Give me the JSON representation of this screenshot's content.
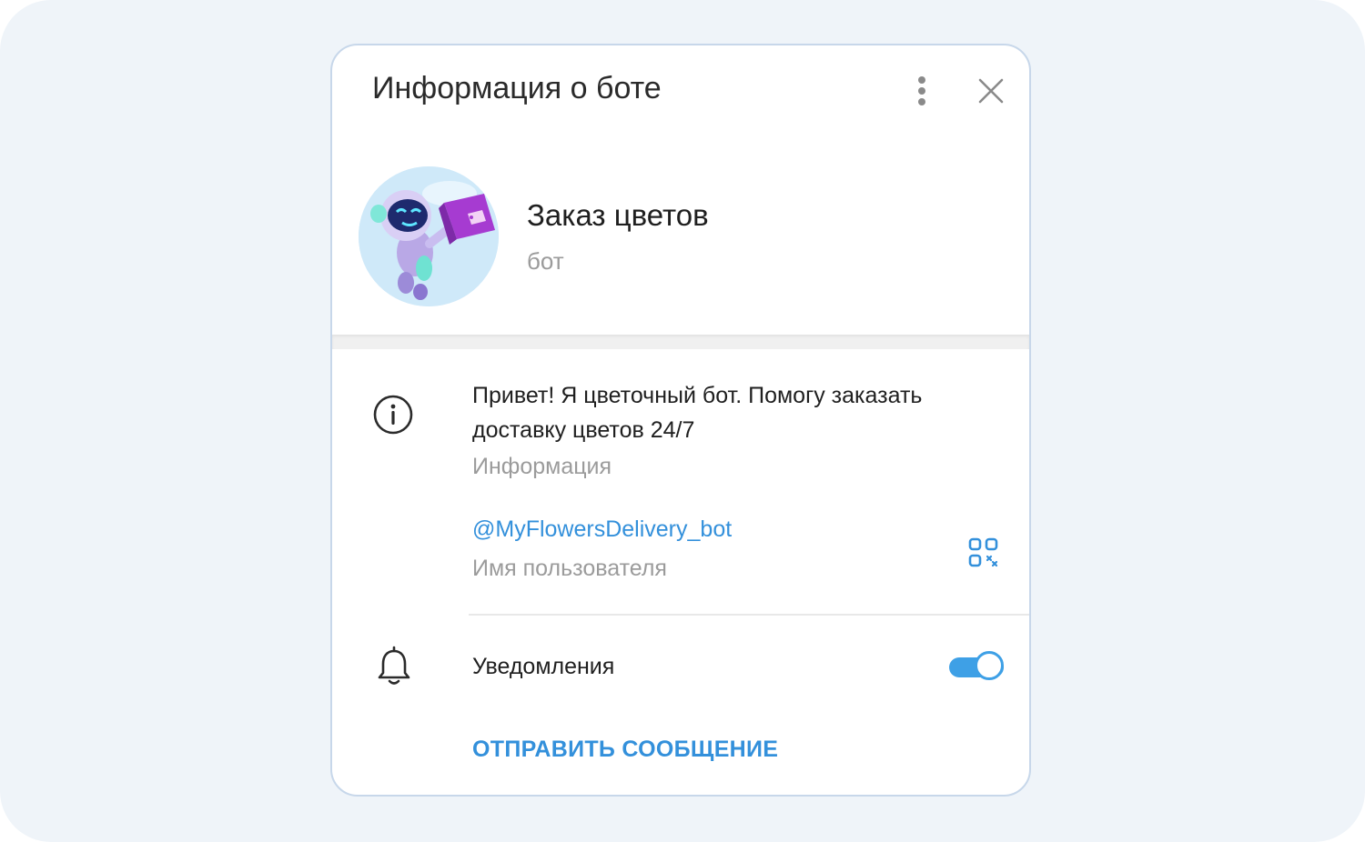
{
  "dialog": {
    "title": "Информация о боте"
  },
  "bot": {
    "name": "Заказ цветов",
    "subtitle": "бот"
  },
  "info": {
    "description": "Привет! Я цветочный бот. Помогу заказать доставку цветов 24/7",
    "description_label": "Информация",
    "username": "@MyFlowersDelivery_bot",
    "username_label": "Имя пользователя"
  },
  "notifications": {
    "label": "Уведомления",
    "enabled": true
  },
  "actions": {
    "send_message": "ОТПРАВИТЬ СООБЩЕНИЕ"
  },
  "icons": {
    "menu": "more-vertical-icon",
    "close": "close-icon",
    "info": "info-icon",
    "qr": "qr-code-icon",
    "bell": "bell-icon"
  },
  "colors": {
    "accent": "#3390db",
    "toggle": "#3ea0e6",
    "border": "#c7d7ea",
    "background": "#eff4f9",
    "muted_text": "#9b9b9b"
  }
}
